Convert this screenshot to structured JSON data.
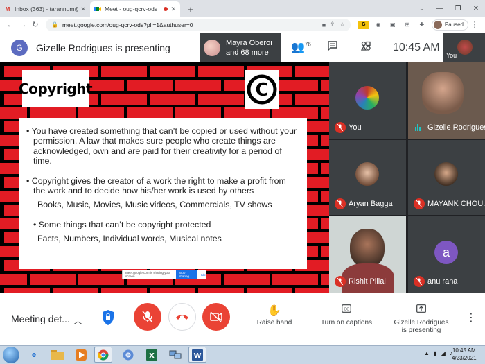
{
  "browser": {
    "tabs": [
      {
        "title": "Inbox (363) - tarannum@theindi",
        "favicon": "gmail-icon",
        "active": false
      },
      {
        "title": "Meet - oug-qcrv-ods",
        "favicon": "meet-icon",
        "active": true,
        "recording": true
      }
    ],
    "new_tab": "+",
    "url": "meet.google.com/oug-qcrv-ods?pli=1&authuser=0",
    "profile_status": "Paused"
  },
  "meet": {
    "presenter_initial": "G",
    "presenting_banner": "Gizelle Rodrigues is presenting",
    "tray_participant": "Mayra Oberoi",
    "tray_more": "and 68 more",
    "people_count": "76",
    "time": "10:45 AM",
    "self_label": "You"
  },
  "slide": {
    "title": "Copyright",
    "logo_symbol": "©",
    "bullet1": "• You have created something that can’t be copied or used without your permission. A law that makes sure people who create things are acknowledged, own and are paid for their creativity for a period of time.",
    "bullet2": "• Copyright gives the creator of a work the right to make a profit from the work and to decide how his/her work is used by others",
    "examples": "Books, Music, Movies, Music videos, Commercials, TV shows",
    "bullet3": "•  Some things that can’t be copyright protected",
    "not_protected": "Facts, Numbers, Individual words, Musical notes",
    "sharing_notice": "meet.google.com is sharing your screen.",
    "stop_sharing": "Stop sharing",
    "hide": "Hide"
  },
  "participants": [
    {
      "name": "You",
      "muted": true
    },
    {
      "name": "Gizelle Rodrigues",
      "muted": false,
      "speaking": true
    },
    {
      "name": "Aryan Bagga",
      "muted": true
    },
    {
      "name": "MAYANK CHOU...",
      "muted": true
    },
    {
      "name": "Rishit Pillai",
      "muted": true
    },
    {
      "name": "anu rana",
      "muted": true,
      "initial": "a"
    }
  ],
  "controls": {
    "meeting_details": "Meeting det...",
    "raise_hand": "Raise hand",
    "captions": "Turn on captions",
    "presenting_line1": "Gizelle Rodrigues",
    "presenting_line2": "is presenting"
  },
  "taskbar": {
    "time": "10:45 AM",
    "date": "4/23/2021",
    "apps": [
      "ie-icon",
      "explorer-icon",
      "media-player-icon",
      "chrome-icon",
      "chrome-icon",
      "excel-icon",
      "network-icon",
      "word-icon"
    ]
  },
  "colors": {
    "brick_red": "#e21c24",
    "meet_red": "#ea4335",
    "presenter_avatar": "#5c6bc0",
    "anu_avatar": "#7e57c2"
  }
}
